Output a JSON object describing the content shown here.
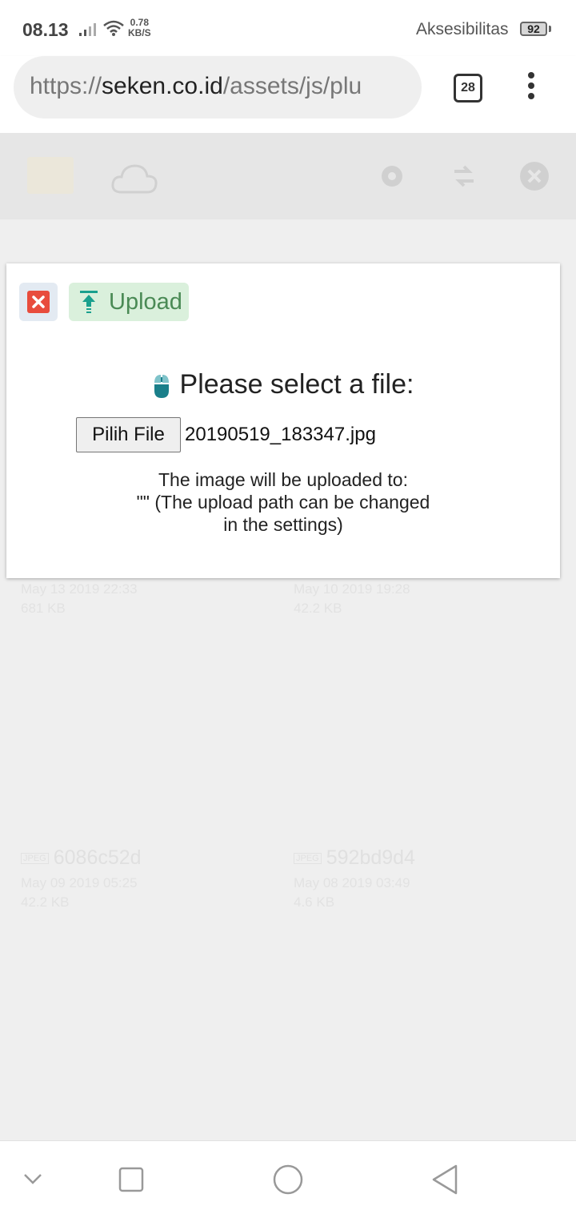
{
  "status_bar": {
    "time": "08.13",
    "speed_value": "0.78",
    "speed_unit": "KB/S",
    "accessibility": "Aksesibilitas",
    "battery": "92"
  },
  "browser": {
    "url_scheme": "https://",
    "url_domain": "seken.co.id",
    "url_path": "/assets/js/plu",
    "tab_count": "28"
  },
  "background_files": [
    {
      "date": "May 13 2019 22:33",
      "size": "681 KB"
    },
    {
      "date": "May 10 2019 19:28",
      "size": "42.2 KB"
    },
    {
      "type": "JPEG",
      "name": "6086c52d",
      "date": "May 09 2019 05:25",
      "size": "42.2 KB"
    },
    {
      "type": "JPEG",
      "name": "592bd9d4",
      "date": "May 08 2019 03:49",
      "size": "4.6 KB"
    }
  ],
  "dialog": {
    "upload_label": "Upload",
    "prompt": "Please select a file:",
    "choose_file_label": "Pilih File",
    "chosen_file": "20190519_183347.jpg",
    "info_line1": "The image will be uploaded to:",
    "info_line2": "\"\" (The upload path can be changed",
    "info_line3": "in the settings)"
  },
  "colors": {
    "close_red": "#e84c3d",
    "upload_green": "#4a8a55",
    "upload_bg": "#daf0dc",
    "mouse_teal": "#1a7f8a"
  }
}
